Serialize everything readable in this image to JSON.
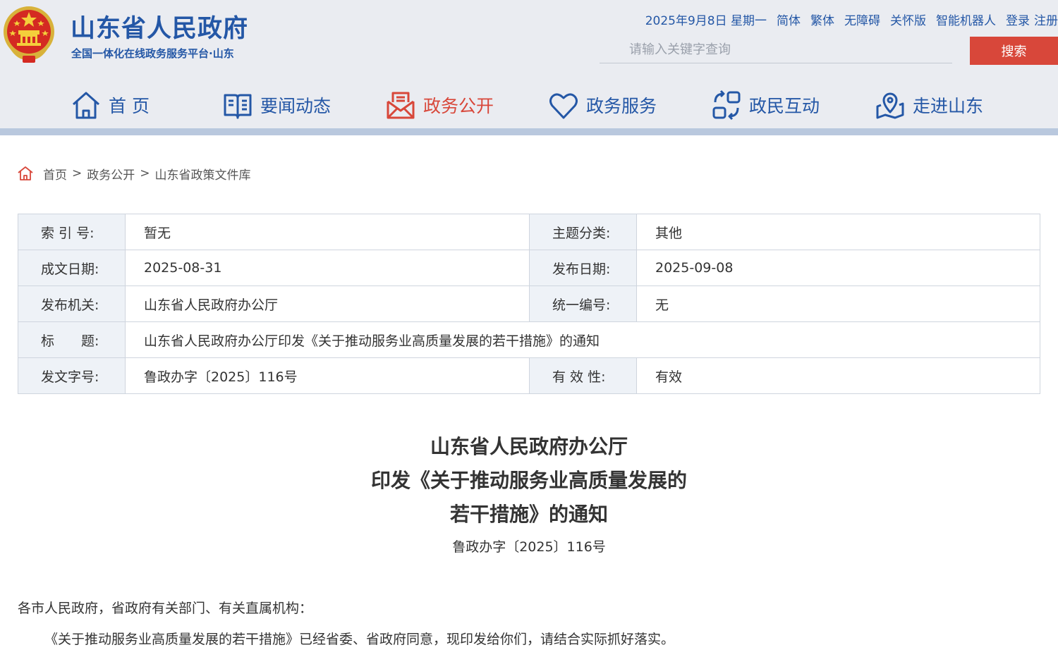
{
  "header": {
    "site_title": "山东省人民政府",
    "site_subtitle": "全国一体化在线政务服务平台·山东",
    "emblem_icon": "national-emblem-icon",
    "colors": {
      "brand": "#2457a6",
      "accent": "#d8473a",
      "header_bg": "#eaecf1"
    }
  },
  "topbar": {
    "date": "2025年9月8日 星期一",
    "links": [
      "简体",
      "繁体",
      "无障碍",
      "关怀版",
      "智能机器人",
      "登录",
      "注册"
    ]
  },
  "search": {
    "placeholder": "请输入关键字查询",
    "value": "",
    "button_label": "搜索"
  },
  "nav": {
    "items": [
      {
        "label": "首 页",
        "icon": "home-icon",
        "active": false
      },
      {
        "label": "要闻动态",
        "icon": "book-icon",
        "active": false
      },
      {
        "label": "政务公开",
        "icon": "envelope-doc-icon",
        "active": true
      },
      {
        "label": "政务服务",
        "icon": "heart-icon",
        "active": false
      },
      {
        "label": "政民互动",
        "icon": "interaction-icon",
        "active": false
      },
      {
        "label": "走进山东",
        "icon": "map-pin-icon",
        "active": false
      }
    ]
  },
  "breadcrumb": {
    "icon": "home-icon",
    "items": [
      "首页",
      "政务公开",
      "山东省政策文件库"
    ],
    "separator": ">"
  },
  "info": {
    "index_label": "索 引 号:",
    "index_value": "暂无",
    "topic_label": "主题分类:",
    "topic_value": "其他",
    "written_date_label": "成文日期:",
    "written_date_value": "2025-08-31",
    "publish_date_label": "发布日期:",
    "publish_date_value": "2025-09-08",
    "issuer_label": "发布机关:",
    "issuer_value": "山东省人民政府办公厅",
    "code_label": "统一编号:",
    "code_value": "无",
    "title_label": "标　　题:",
    "title_value": "山东省人民政府办公厅印发《关于推动服务业高质量发展的若干措施》的通知",
    "doc_no_label": "发文字号:",
    "doc_no_value": "鲁政办字〔2025〕116号",
    "validity_label": "有 效 性:",
    "validity_value": "有效"
  },
  "document": {
    "title_lines": [
      "山东省人民政府办公厅",
      "印发《关于推动服务业高质量发展的",
      "若干措施》的通知"
    ],
    "doc_number": "鲁政办字〔2025〕116号",
    "addressee": "各市人民政府，省政府有关部门、有关直属机构：",
    "paragraph_1": "《关于推动服务业高质量发展的若干措施》已经省委、省政府同意，现印发给你们，请结合实际抓好落实。"
  }
}
